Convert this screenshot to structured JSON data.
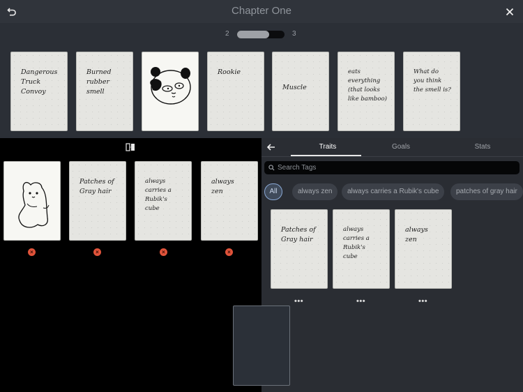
{
  "header": {
    "title": "Chapter One",
    "back_icon": "undo-icon",
    "close_icon": "close-icon"
  },
  "pager": {
    "current": "2",
    "next": "3",
    "progress": 0.67
  },
  "top_cards": [
    {
      "text": "Dangerous\nTruck\nConvoy"
    },
    {
      "text": "Burned\nrubber\nsmell"
    },
    {
      "text": "",
      "image": "panda-drawing"
    },
    {
      "text": "Rookie"
    },
    {
      "text": "Muscle"
    },
    {
      "text": "eats\neverything\n(that looks\nlike bamboo)"
    },
    {
      "text": "What do\nyou think\nthe smell is?"
    }
  ],
  "selected_cards": [
    {
      "text": "",
      "image": "seal-drawing"
    },
    {
      "text": "Patches of\nGray hair"
    },
    {
      "text": "always\ncarries a\nRubik's\ncube"
    },
    {
      "text": "always\nzen"
    }
  ],
  "panel": {
    "tabs": [
      "Traits",
      "Goals",
      "Stats"
    ],
    "active_tab": "Traits",
    "search_placeholder": "Search Tags",
    "chips": [
      "All",
      "always zen",
      "always carries a Rubik's cube",
      "patches of gray hair"
    ],
    "trait_cards": [
      {
        "text": "Patches of\nGray hair"
      },
      {
        "text": "always\ncarries a\nRubik's\ncube"
      },
      {
        "text": "always\nzen"
      }
    ],
    "more_label": "•••"
  },
  "colors": {
    "delete": "#e0533a",
    "accent": "#8aa9d6"
  }
}
